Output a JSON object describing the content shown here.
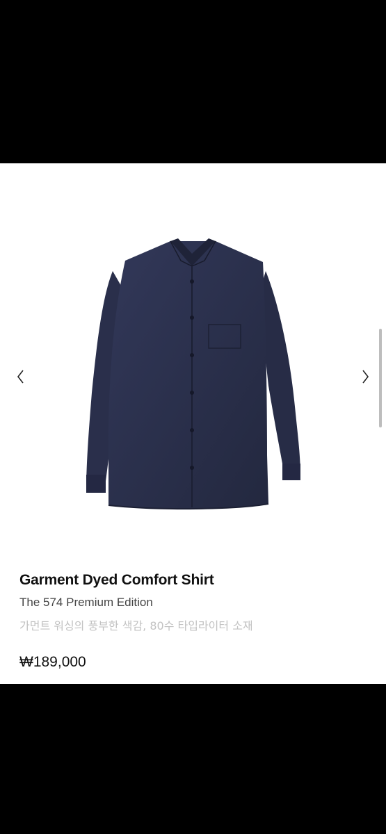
{
  "product": {
    "title": "Garment Dyed Comfort Shirt",
    "subtitle": "The 574 Premium Edition",
    "description": "가먼트 워싱의 풍부한 색감, 80수 타입라이터 소재",
    "price": "₩189,000"
  },
  "gallery": {
    "prev_icon": "chevron-left-icon",
    "next_icon": "chevron-right-icon"
  },
  "colors": {
    "shirt": "#2a2f4e",
    "background": "#ffffff",
    "letterbox": "#000000",
    "description_text": "#c2c2c2"
  }
}
